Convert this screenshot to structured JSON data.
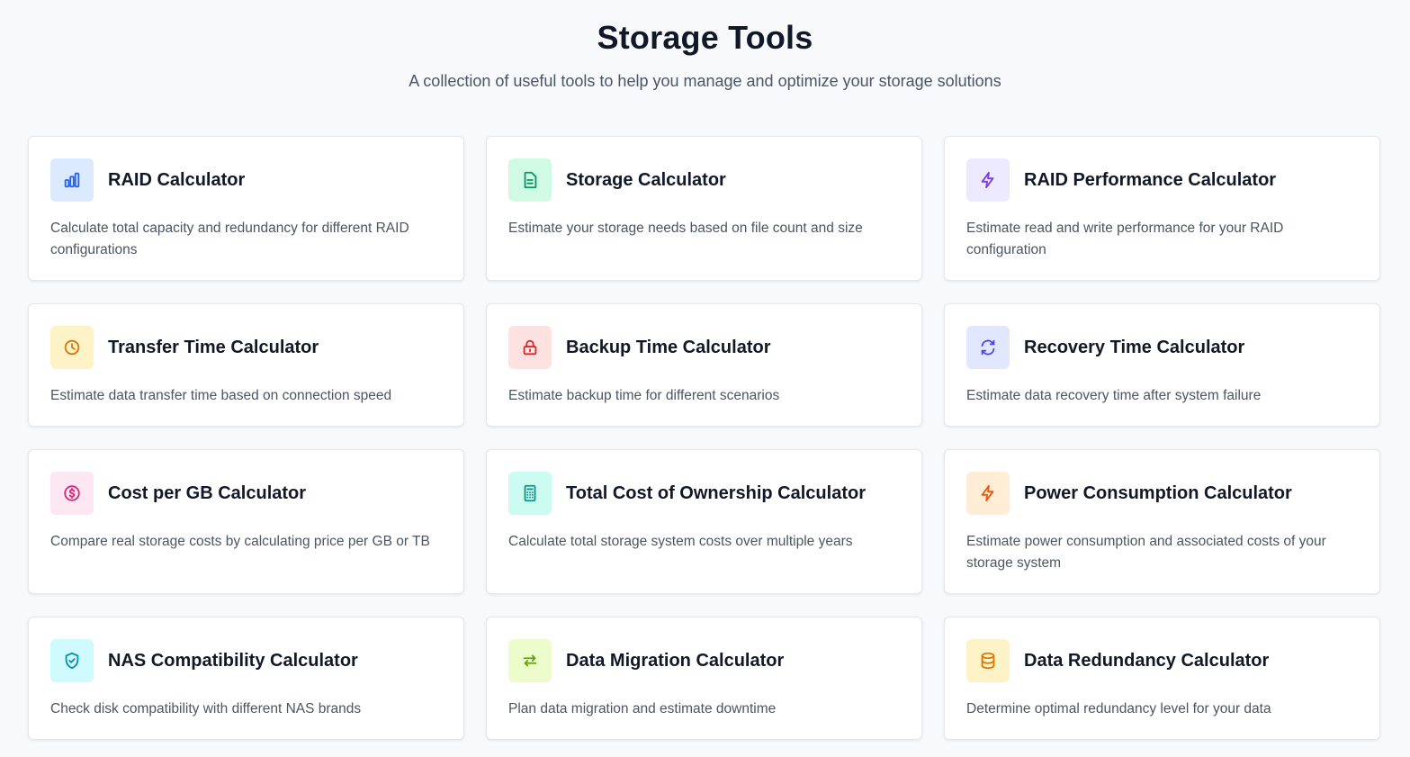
{
  "header": {
    "title": "Storage Tools",
    "subtitle": "A collection of useful tools to help you manage and optimize your storage solutions"
  },
  "tools": [
    {
      "title": "RAID Calculator",
      "description": "Calculate total capacity and redundancy for different RAID configurations",
      "icon": "bar-chart-icon",
      "icon_bg": "#dbeafe",
      "icon_color": "#2563eb"
    },
    {
      "title": "Storage Calculator",
      "description": "Estimate your storage needs based on file count and size",
      "icon": "document-icon",
      "icon_bg": "#d1fae5",
      "icon_color": "#059669"
    },
    {
      "title": "RAID Performance Calculator",
      "description": "Estimate read and write performance for your RAID configuration",
      "icon": "lightning-icon",
      "icon_bg": "#ede9fe",
      "icon_color": "#7c3aed"
    },
    {
      "title": "Transfer Time Calculator",
      "description": "Estimate data transfer time based on connection speed",
      "icon": "clock-icon",
      "icon_bg": "#fef3c7",
      "icon_color": "#d97706"
    },
    {
      "title": "Backup Time Calculator",
      "description": "Estimate backup time for different scenarios",
      "icon": "lock-icon",
      "icon_bg": "#fee2e2",
      "icon_color": "#dc2626"
    },
    {
      "title": "Recovery Time Calculator",
      "description": "Estimate data recovery time after system failure",
      "icon": "refresh-icon",
      "icon_bg": "#e0e7ff",
      "icon_color": "#4f46e5"
    },
    {
      "title": "Cost per GB Calculator",
      "description": "Compare real storage costs by calculating price per GB or TB",
      "icon": "dollar-icon",
      "icon_bg": "#fce7f3",
      "icon_color": "#db2777"
    },
    {
      "title": "Total Cost of Ownership Calculator",
      "description": "Calculate total storage system costs over multiple years",
      "icon": "calculator-icon",
      "icon_bg": "#ccfbf1",
      "icon_color": "#0d9488"
    },
    {
      "title": "Power Consumption Calculator",
      "description": "Estimate power consumption and associated costs of your storage system",
      "icon": "lightning-icon",
      "icon_bg": "#ffedd5",
      "icon_color": "#ea580c"
    },
    {
      "title": "NAS Compatibility Calculator",
      "description": "Check disk compatibility with different NAS brands",
      "icon": "shield-check-icon",
      "icon_bg": "#cffafe",
      "icon_color": "#0891b2"
    },
    {
      "title": "Data Migration Calculator",
      "description": "Plan data migration and estimate downtime",
      "icon": "arrows-swap-icon",
      "icon_bg": "#ecfccb",
      "icon_color": "#65a30d"
    },
    {
      "title": "Data Redundancy Calculator",
      "description": "Determine optimal redundancy level for your data",
      "icon": "database-icon",
      "icon_bg": "#fef3c7",
      "icon_color": "#d97706"
    }
  ]
}
